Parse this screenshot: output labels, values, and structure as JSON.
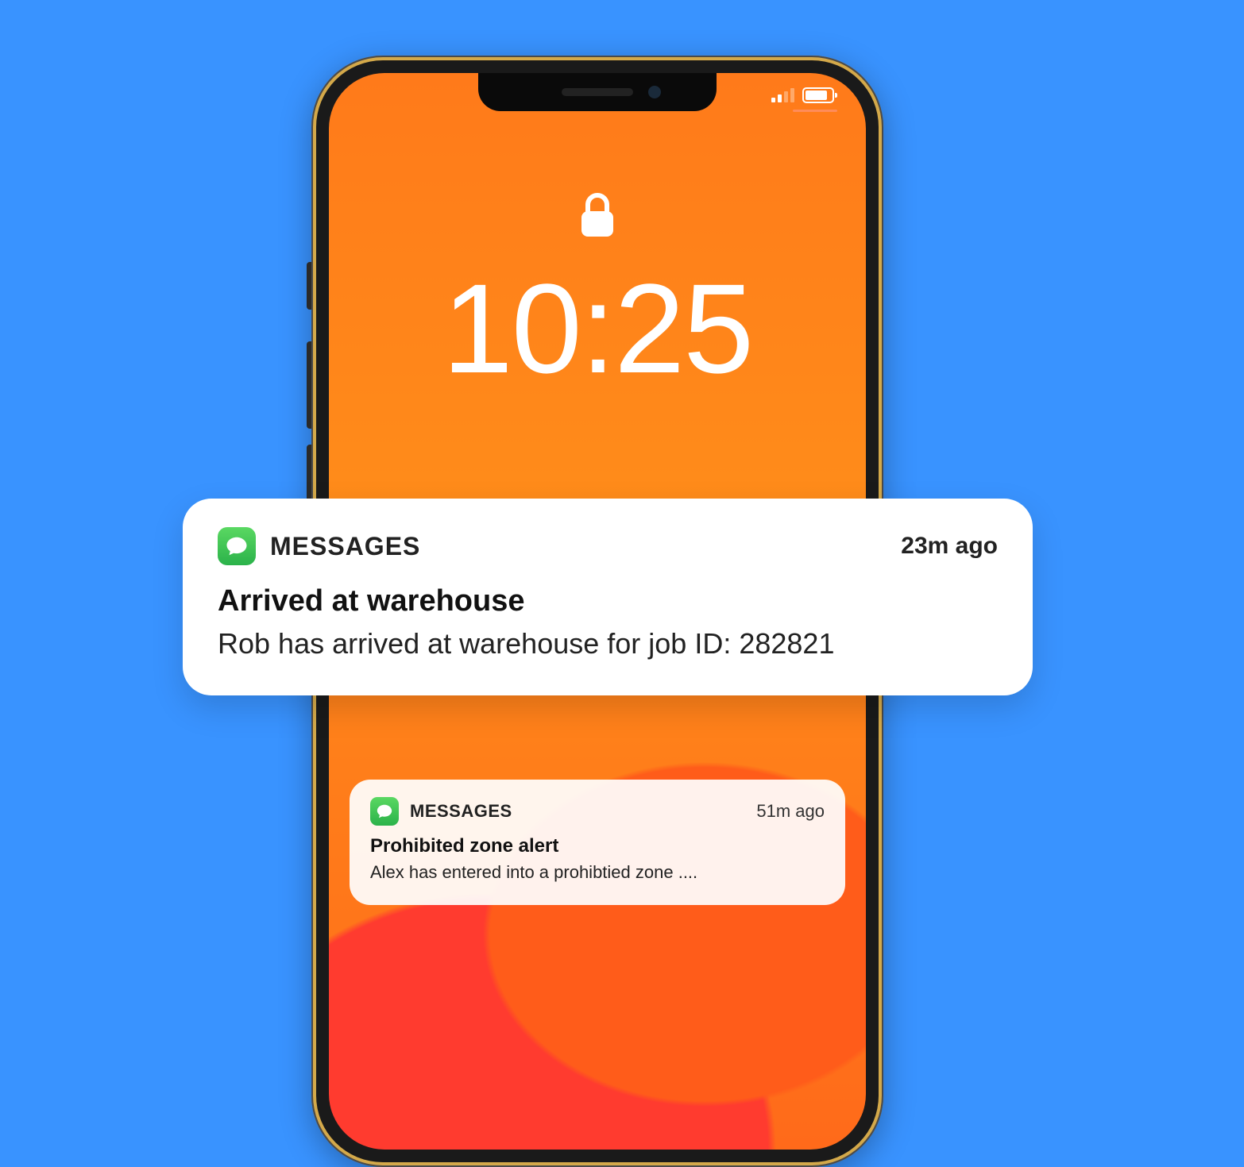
{
  "lockscreen": {
    "time": "10:25"
  },
  "notifications": [
    {
      "app": "MESSAGES",
      "time": "23m ago",
      "title": "Arrived at warehouse",
      "body": "Rob has arrived at warehouse for job ID: 282821"
    },
    {
      "app": "MESSAGES",
      "time": "51m ago",
      "title": "Prohibited zone alert",
      "body": "Alex has entered into a prohibtied zone ...."
    }
  ]
}
